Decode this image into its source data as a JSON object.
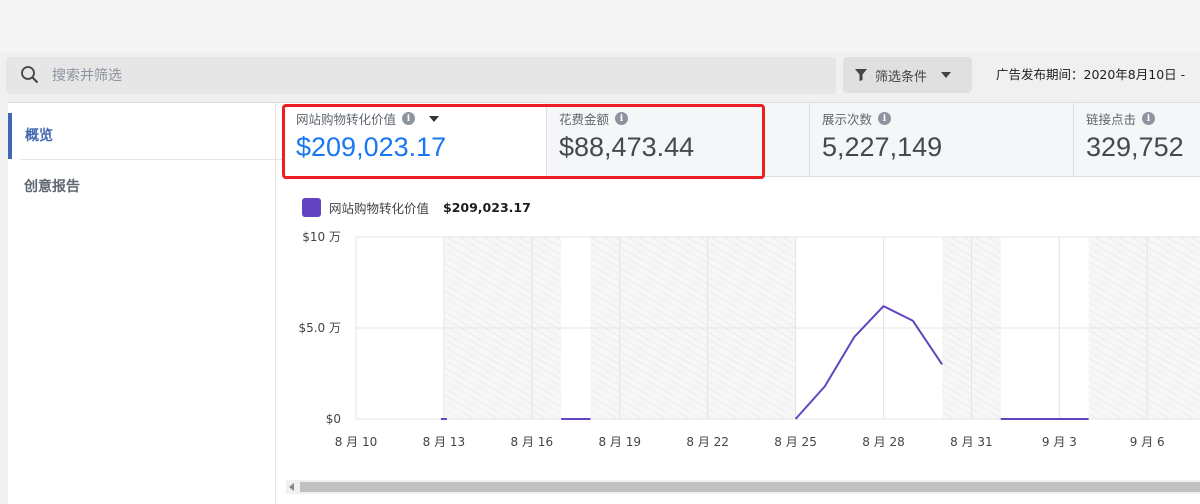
{
  "search": {
    "placeholder": "搜索并筛选"
  },
  "filter": {
    "label": "筛选条件"
  },
  "period": {
    "text": "广告发布期间：2020年8月10日 -"
  },
  "sidebar": {
    "items": [
      {
        "label": "概览"
      },
      {
        "label": "创意报告"
      }
    ]
  },
  "metrics": [
    {
      "label": "网站购物转化价值",
      "value": "$209,023.17"
    },
    {
      "label": "花费金额",
      "value": "$88,473.44"
    },
    {
      "label": "展示次数",
      "value": "5,227,149"
    },
    {
      "label": "链接点击",
      "value": "329,752"
    }
  ],
  "colors": {
    "accent": "#1877f2",
    "series": "#6244c3",
    "highlight": "#ee1c25",
    "nav_active": "#4267b2"
  },
  "icons": {
    "search": "search-icon",
    "filter": "funnel-icon",
    "info": "info-icon"
  },
  "chart_data": {
    "type": "line",
    "ytick_labels": [
      "$0",
      "$5.0 万",
      "$10 万"
    ],
    "ylim": [
      0,
      100000
    ],
    "yticks": [
      0,
      50000,
      100000
    ],
    "xtick_labels": [
      "8 月 10",
      "8 月 13",
      "8 月 16",
      "8 月 19",
      "8 月 22",
      "8 月 25",
      "8 月 28",
      "8 月 31",
      "9 月 3",
      "9 月 6"
    ],
    "xtick_days": [
      0,
      3,
      6,
      9,
      12,
      15,
      18,
      21,
      24,
      27
    ],
    "xlim": [
      0,
      28.8
    ],
    "grid": true,
    "shaded_ranges": [
      [
        3,
        7
      ],
      [
        8,
        15
      ],
      [
        20,
        22
      ],
      [
        25,
        28.8
      ]
    ],
    "series": [
      {
        "name": "网站购物转化价值",
        "total": "$209,023.17",
        "segments": [
          [
            [
              3,
              0
            ]
          ],
          [
            [
              7,
              0
            ],
            [
              8,
              0
            ]
          ],
          [
            [
              15,
              0
            ],
            [
              16,
              18000
            ],
            [
              17,
              45000
            ],
            [
              18,
              62000
            ],
            [
              19,
              54000
            ],
            [
              20,
              30000
            ]
          ],
          [
            [
              22,
              0
            ],
            [
              25,
              0
            ]
          ]
        ]
      }
    ]
  }
}
